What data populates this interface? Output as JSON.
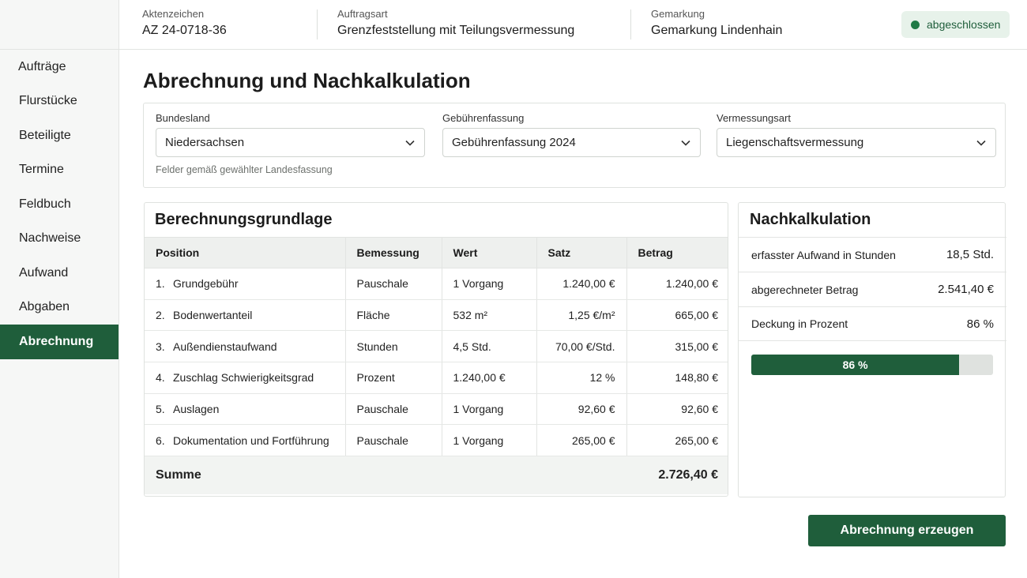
{
  "sidebar": {
    "items": [
      {
        "label": "Aufträge"
      },
      {
        "label": "Flurstücke"
      },
      {
        "label": "Beteiligte"
      },
      {
        "label": "Termine"
      },
      {
        "label": "Feldbuch"
      },
      {
        "label": "Nachweise"
      },
      {
        "label": "Aufwand"
      },
      {
        "label": "Abgaben"
      },
      {
        "label": "Abrechnung"
      }
    ],
    "active": "Abrechnung"
  },
  "header": {
    "aktenzeichen": {
      "label": "Aktenzeichen",
      "value": "AZ 24-0718-36"
    },
    "auftragsart": {
      "label": "Auftragsart",
      "value": "Grenzfeststellung mit Teilungsvermessung"
    },
    "gemarkung": {
      "label": "Gemarkung",
      "value": "Gemarkung Lindenhain"
    },
    "status": "abgeschlossen"
  },
  "page": {
    "title": "Abrechnung und Nachkalkulation"
  },
  "filters": {
    "bundesland": {
      "label": "Bundesland",
      "value": "Niedersachsen"
    },
    "gebuehrenfassung": {
      "label": "Gebührenfassung",
      "value": "Gebührenfassung 2024"
    },
    "vermessungsart": {
      "label": "Vermessungsart",
      "value": "Liegenschaftsvermessung"
    },
    "hint": "Felder gemäß gewählter Landesfassung"
  },
  "calculation": {
    "title": "Berechnungsgrundlage",
    "columns": [
      "Position",
      "Bemessung",
      "Wert",
      "Satz",
      "Betrag"
    ],
    "rows": [
      {
        "index": "1.",
        "position": "Grundgebühr",
        "bemessung": "Pauschale",
        "wert": "1 Vorgang",
        "satz": "1.240,00 €",
        "betrag": "1.240,00 €"
      },
      {
        "index": "2.",
        "position": "Bodenwertanteil",
        "bemessung": "Fläche",
        "wert": "532 m²",
        "satz": "1,25 €/m²",
        "betrag": "665,00 €"
      },
      {
        "index": "3.",
        "position": "Außendienstaufwand",
        "bemessung": "Stunden",
        "wert": "4,5 Std.",
        "satz": "70,00 €/Std.",
        "betrag": "315,00 €"
      },
      {
        "index": "4.",
        "position": "Zuschlag Schwierigkeitsgrad",
        "bemessung": "Prozent",
        "wert": "1.240,00 €",
        "satz": "12 %",
        "betrag": "148,80 €"
      },
      {
        "index": "5.",
        "position": "Auslagen",
        "bemessung": "Pauschale",
        "wert": "1 Vorgang",
        "satz": "92,60 €",
        "betrag": "92,60 €"
      },
      {
        "index": "6.",
        "position": "Dokumentation und Fortführung",
        "bemessung": "Pauschale",
        "wert": "1 Vorgang",
        "satz": "265,00 €",
        "betrag": "265,00 €"
      }
    ],
    "sum_label": "Summe",
    "sum_value": "2.726,40 €"
  },
  "post_calculation": {
    "title": "Nachkalkulation",
    "rows": [
      {
        "label": "erfasster Aufwand in Stunden",
        "value": "18,5 Std."
      },
      {
        "label": "abgerechneter Betrag",
        "value": "2.541,40 €"
      },
      {
        "label": "Deckung in Prozent",
        "value": "86 %"
      }
    ],
    "coverage_percent": 86,
    "coverage_label": "86 %"
  },
  "actions": {
    "create_invoice": "Abrechnung erzeugen"
  },
  "colors": {
    "primary": "#1f5e3b",
    "status_bg": "#e7f2ea",
    "status_dot": "#1f7a45"
  }
}
